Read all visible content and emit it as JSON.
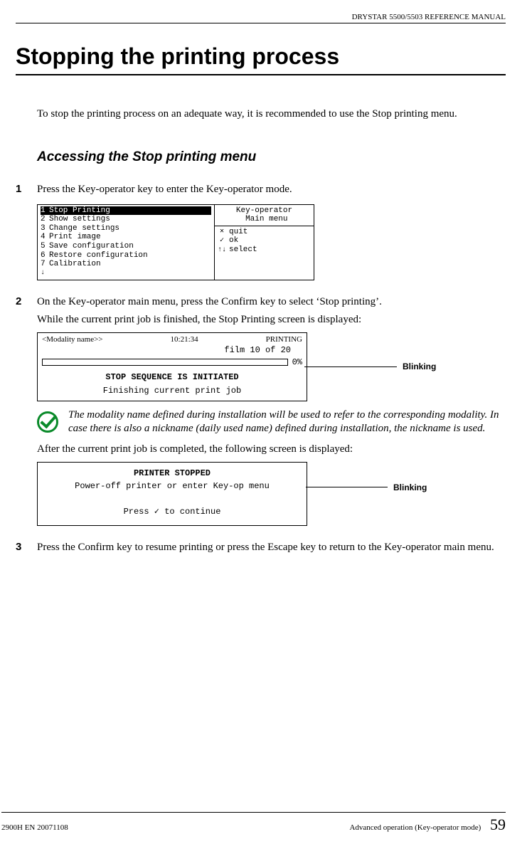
{
  "header": "DRYSTAR 5500/5503 REFERENCE MANUAL",
  "title": "Stopping the printing process",
  "intro": "To stop the printing process on an adequate way, it is recommended to use the Stop printing menu.",
  "subhead": "Accessing the Stop printing menu",
  "steps": {
    "s1": {
      "num": "1",
      "text": "Press the Key-operator key to enter the Key-operator mode."
    },
    "s2": {
      "num": "2",
      "text": "On the Key-operator main menu, press the Confirm key to select ‘Stop printing’.",
      "sub": "While the current print job is finished, the Stop Printing screen is displayed:"
    },
    "s3": {
      "num": "3",
      "text": "Press the Confirm key to resume printing or press the Escape key to return to the Key-operator main menu."
    }
  },
  "lcd1": {
    "items": [
      {
        "n": "1",
        "label": "Stop Printing"
      },
      {
        "n": "2",
        "label": "Show settings"
      },
      {
        "n": "3",
        "label": "Change settings"
      },
      {
        "n": "4",
        "label": "Print image"
      },
      {
        "n": "5",
        "label": "Save configuration"
      },
      {
        "n": "6",
        "label": "Restore configuration"
      },
      {
        "n": "7",
        "label": "Calibration"
      }
    ],
    "right_title": "Key-operator\n Main menu",
    "keys": {
      "quit": "quit",
      "ok": "ok",
      "select": "select"
    }
  },
  "lcd2": {
    "modality": "<Modality name>>",
    "time": "10:21:34",
    "status": "PRINTING",
    "filmrow": "film  10 of  20",
    "pct": "0%",
    "line1": "STOP SEQUENCE IS INITIATED",
    "line2": "Finishing current print job",
    "callout": "Blinking"
  },
  "note": "The modality name defined during installation will be used to refer to the corresponding modality. In case there is also a nickname (daily used name) defined during installation, the nickname is used.",
  "after_note": "After the current print job is completed, the following screen is displayed:",
  "lcd3": {
    "title": "PRINTER STOPPED",
    "line1": "Power-off printer or enter Key-op menu",
    "line2": "Press ✓ to continue",
    "callout": "Blinking"
  },
  "footer": {
    "left": "2900H EN 20071108",
    "right": "Advanced operation (Key-operator mode)",
    "page": "59"
  }
}
